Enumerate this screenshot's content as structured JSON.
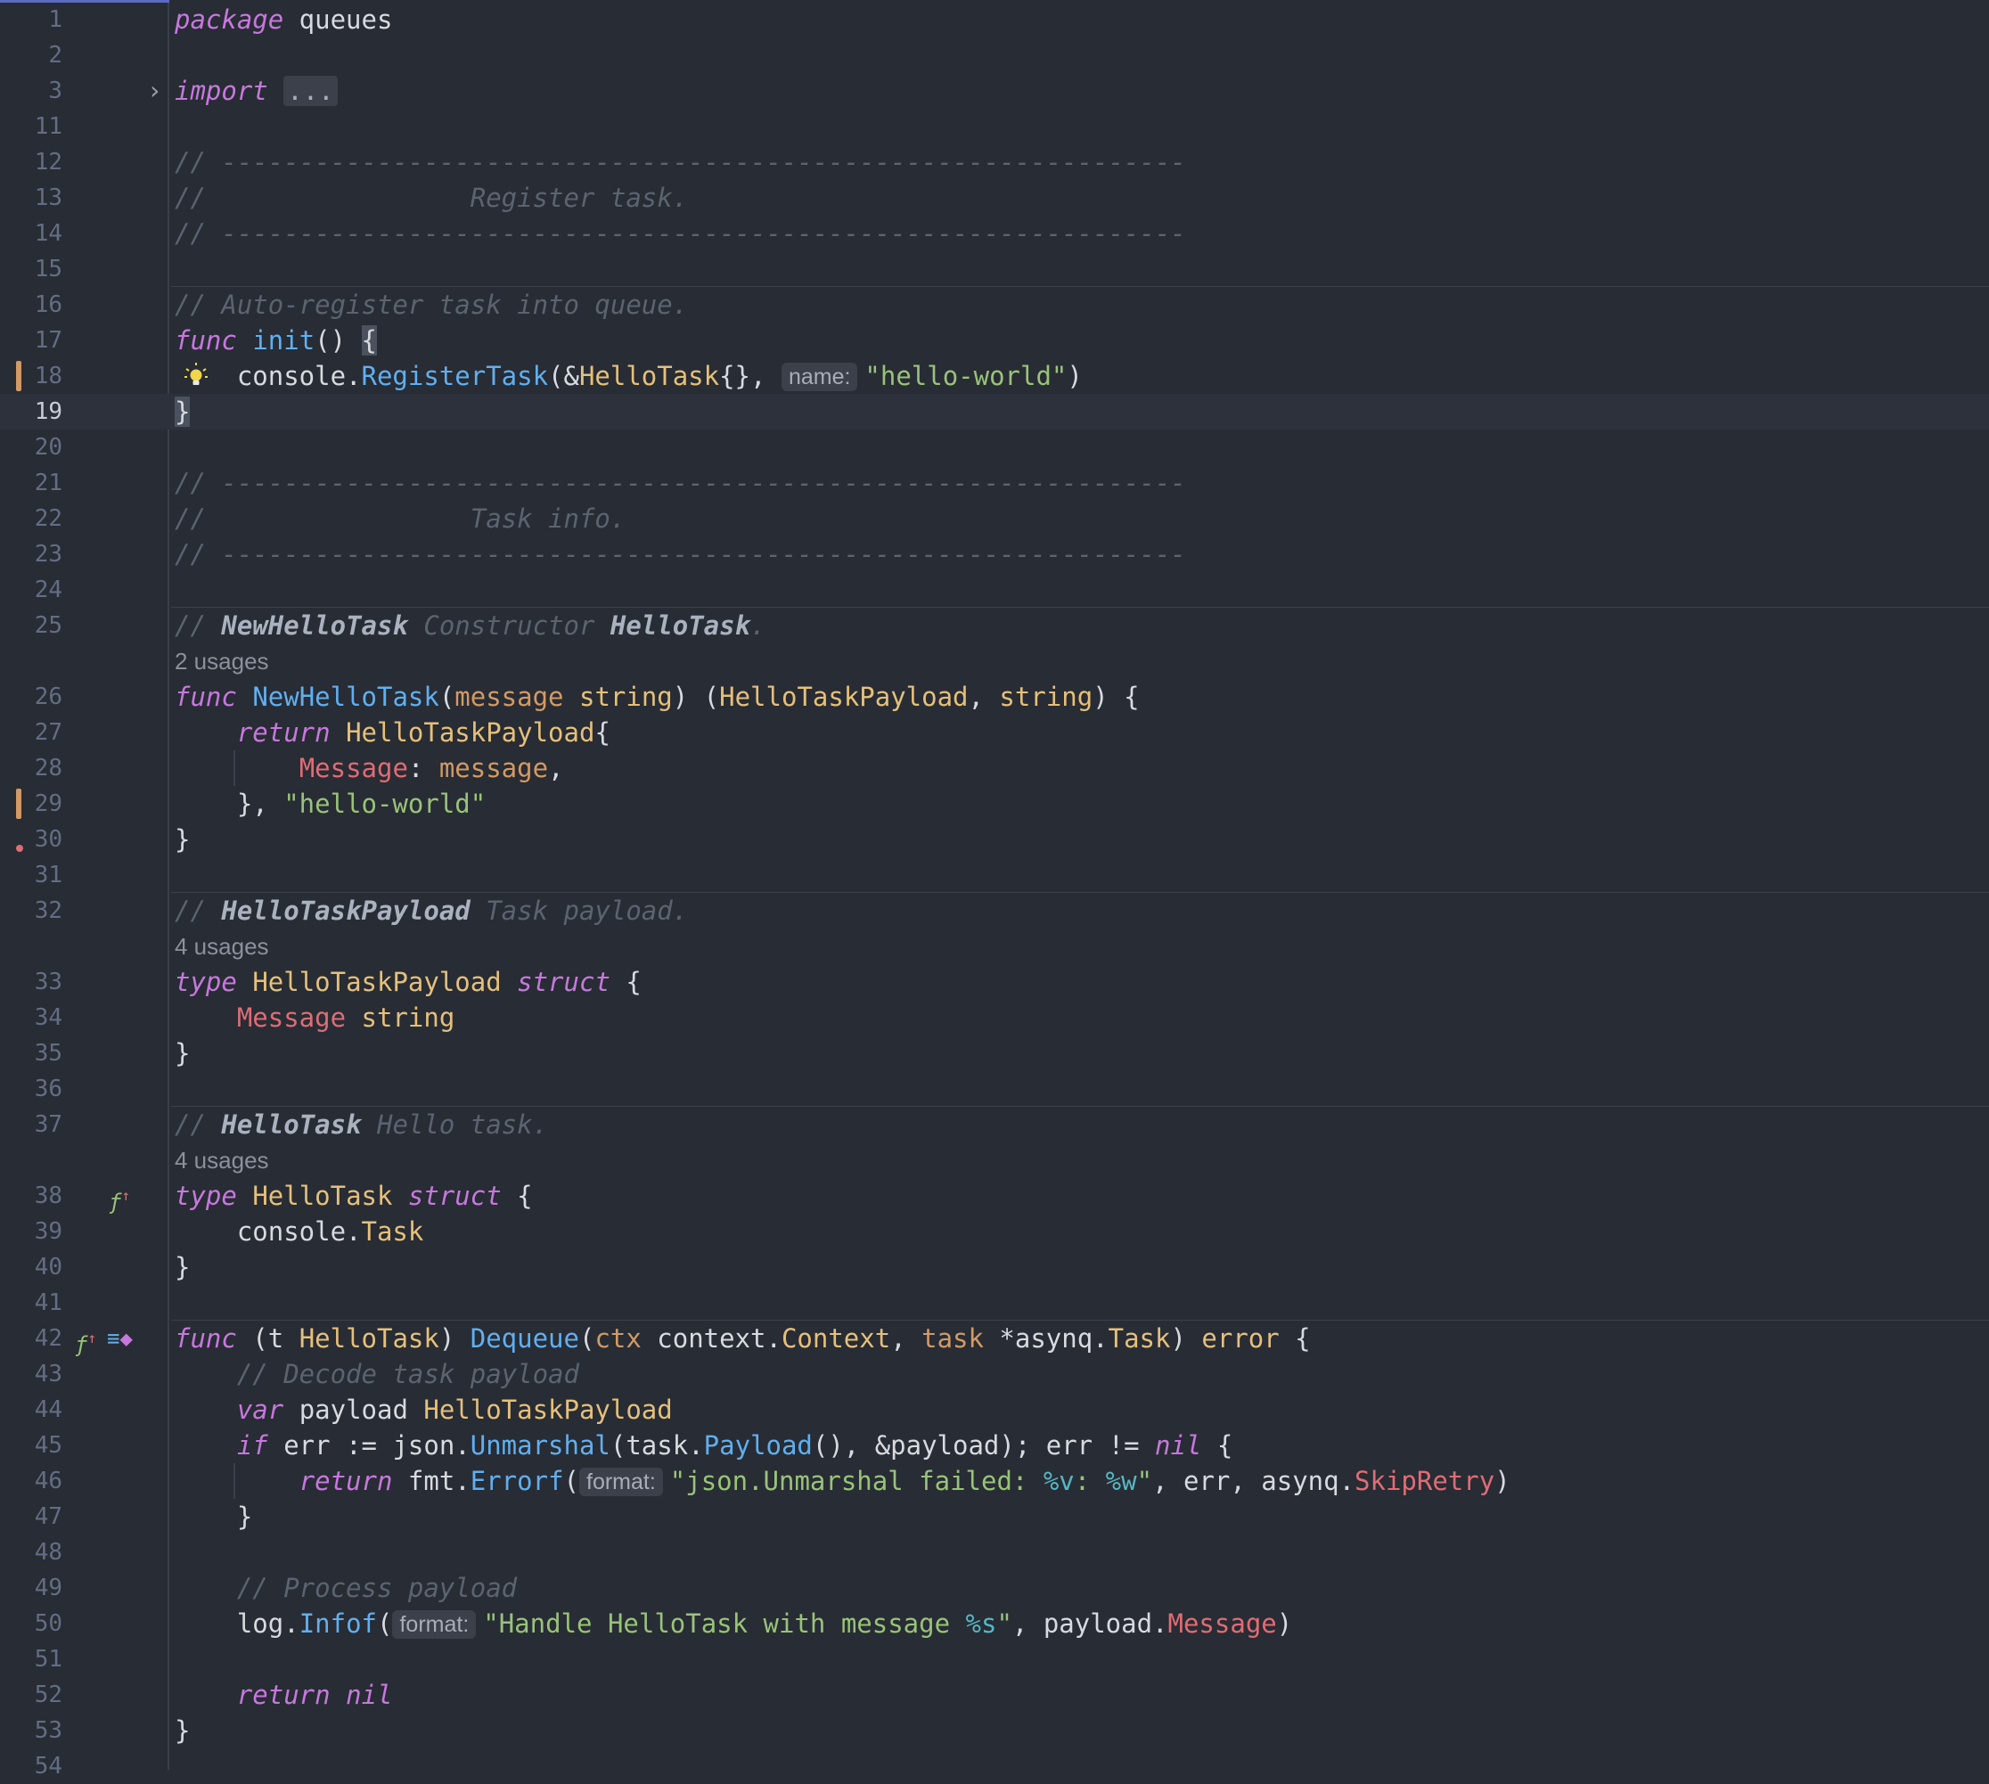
{
  "editor": {
    "language": "go",
    "colors": {
      "background": "#282c34",
      "keyword": "#c678dd",
      "function": "#61afef",
      "type": "#e5c07b",
      "string": "#98c379",
      "comment": "#5c6370",
      "field": "#e06c75",
      "parameter": "#d19a66"
    },
    "current_line": 19,
    "lines": [
      {
        "n": "1",
        "t": "package queues"
      },
      {
        "n": "2",
        "t": ""
      },
      {
        "n": "3",
        "t": "import ..."
      },
      {
        "n": "11",
        "t": ""
      },
      {
        "n": "12",
        "t": "// --------------------------------------------------------------"
      },
      {
        "n": "13",
        "t": "//                 Register task."
      },
      {
        "n": "14",
        "t": "// --------------------------------------------------------------"
      },
      {
        "n": "15",
        "t": ""
      },
      {
        "n": "16",
        "t": "// Auto-register task into queue."
      },
      {
        "n": "17",
        "t": "func init() {"
      },
      {
        "n": "18",
        "t": "    console.RegisterTask(&HelloTask{}, name: \"hello-world\")"
      },
      {
        "n": "19",
        "t": "}"
      },
      {
        "n": "20",
        "t": ""
      },
      {
        "n": "21",
        "t": "// --------------------------------------------------------------"
      },
      {
        "n": "22",
        "t": "//                 Task info."
      },
      {
        "n": "23",
        "t": "// --------------------------------------------------------------"
      },
      {
        "n": "24",
        "t": ""
      },
      {
        "n": "25",
        "t": "// NewHelloTask Constructor HelloTask."
      },
      {
        "n": "",
        "t": "2 usages"
      },
      {
        "n": "26",
        "t": "func NewHelloTask(message string) (HelloTaskPayload, string) {"
      },
      {
        "n": "27",
        "t": "    return HelloTaskPayload{"
      },
      {
        "n": "28",
        "t": "        Message: message,"
      },
      {
        "n": "29",
        "t": "    }, \"hello-world\""
      },
      {
        "n": "30",
        "t": "}"
      },
      {
        "n": "31",
        "t": ""
      },
      {
        "n": "32",
        "t": "// HelloTaskPayload Task payload."
      },
      {
        "n": "",
        "t": "4 usages"
      },
      {
        "n": "33",
        "t": "type HelloTaskPayload struct {"
      },
      {
        "n": "34",
        "t": "    Message string"
      },
      {
        "n": "35",
        "t": "}"
      },
      {
        "n": "36",
        "t": ""
      },
      {
        "n": "37",
        "t": "// HelloTask Hello task."
      },
      {
        "n": "",
        "t": "4 usages"
      },
      {
        "n": "38",
        "t": "type HelloTask struct {"
      },
      {
        "n": "39",
        "t": "    console.Task"
      },
      {
        "n": "40",
        "t": "}"
      },
      {
        "n": "41",
        "t": ""
      },
      {
        "n": "42",
        "t": "func (t HelloTask) Dequeue(ctx context.Context, task *asynq.Task) error {"
      },
      {
        "n": "43",
        "t": "    // Decode task payload"
      },
      {
        "n": "44",
        "t": "    var payload HelloTaskPayload"
      },
      {
        "n": "45",
        "t": "    if err := json.Unmarshal(task.Payload(), &payload); err != nil {"
      },
      {
        "n": "46",
        "t": "        return fmt.Errorf(format: \"json.Unmarshal failed: %v: %w\", err, asynq.SkipRetry)"
      },
      {
        "n": "47",
        "t": "    }"
      },
      {
        "n": "48",
        "t": ""
      },
      {
        "n": "49",
        "t": "    // Process payload"
      },
      {
        "n": "50",
        "t": "    log.Infof(format: \"Handle HelloTask with message %s\", payload.Message)"
      },
      {
        "n": "51",
        "t": ""
      },
      {
        "n": "52",
        "t": "    return nil"
      },
      {
        "n": "53",
        "t": "}"
      },
      {
        "n": "54",
        "t": ""
      }
    ],
    "gutter_icons": [
      {
        "line": "3",
        "icon": "fold-chevron-icon"
      },
      {
        "line": "18",
        "icon": "lightbulb-icon"
      },
      {
        "line": "38",
        "icon": "implements-interface-icon"
      },
      {
        "line": "42",
        "icon": "implements-method-icon"
      },
      {
        "line": "42",
        "icon": "go-method-icon"
      }
    ],
    "change_markers": [
      "18",
      "29"
    ],
    "error_marker_line": "31"
  }
}
